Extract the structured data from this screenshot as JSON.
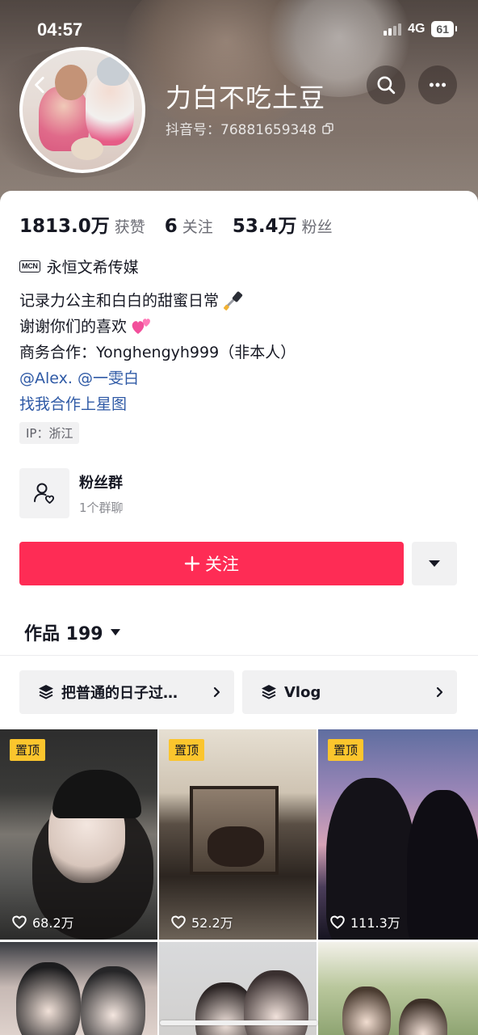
{
  "status_bar": {
    "time": "04:57",
    "network": "4G",
    "battery": "61"
  },
  "profile": {
    "nickname": "力白不吃土豆",
    "douyin_id": "抖音号：76881659348"
  },
  "stats": [
    {
      "value": "1813.0万",
      "label": "获赞"
    },
    {
      "value": "6",
      "label": "关注"
    },
    {
      "value": "53.4万",
      "label": "粉丝"
    }
  ],
  "mcn": {
    "badge": "MCN",
    "name": "永恒文希传媒"
  },
  "bio": {
    "line1": "记录力公主和白白的甜蜜日常",
    "line2": "谢谢你们的喜欢",
    "line3": "商务合作：Yonghengyh999（非本人）",
    "mentions": "@Alex. @一雯白",
    "star_link": "找我合作上星图"
  },
  "ip_location": "IP：浙江",
  "fans_group": {
    "title": "粉丝群",
    "subtitle": "1个群聊"
  },
  "follow_button": {
    "label": "关注"
  },
  "works_tab": {
    "label": "作品 199"
  },
  "collections": [
    {
      "title": "把普通的日子过…"
    },
    {
      "title": "Vlog"
    }
  ],
  "videos": [
    {
      "pinned_label": "置顶",
      "likes": "68.2万"
    },
    {
      "pinned_label": "置顶",
      "likes": "52.2万"
    },
    {
      "pinned_label": "置顶",
      "likes": "111.3万"
    },
    {
      "pinned_label": "",
      "likes": ""
    },
    {
      "pinned_label": "",
      "likes": ""
    },
    {
      "pinned_label": "",
      "likes": ""
    }
  ],
  "colors": {
    "accent": "#fe2c55",
    "link": "#2f5aa6",
    "pin": "#fbc52d"
  },
  "icons": [
    "back-icon",
    "search-icon",
    "more-icon",
    "copy-icon",
    "fans-group-icon",
    "plus-icon",
    "caret-down-icon",
    "stack-icon",
    "chevron-right-icon",
    "heart-icon"
  ]
}
